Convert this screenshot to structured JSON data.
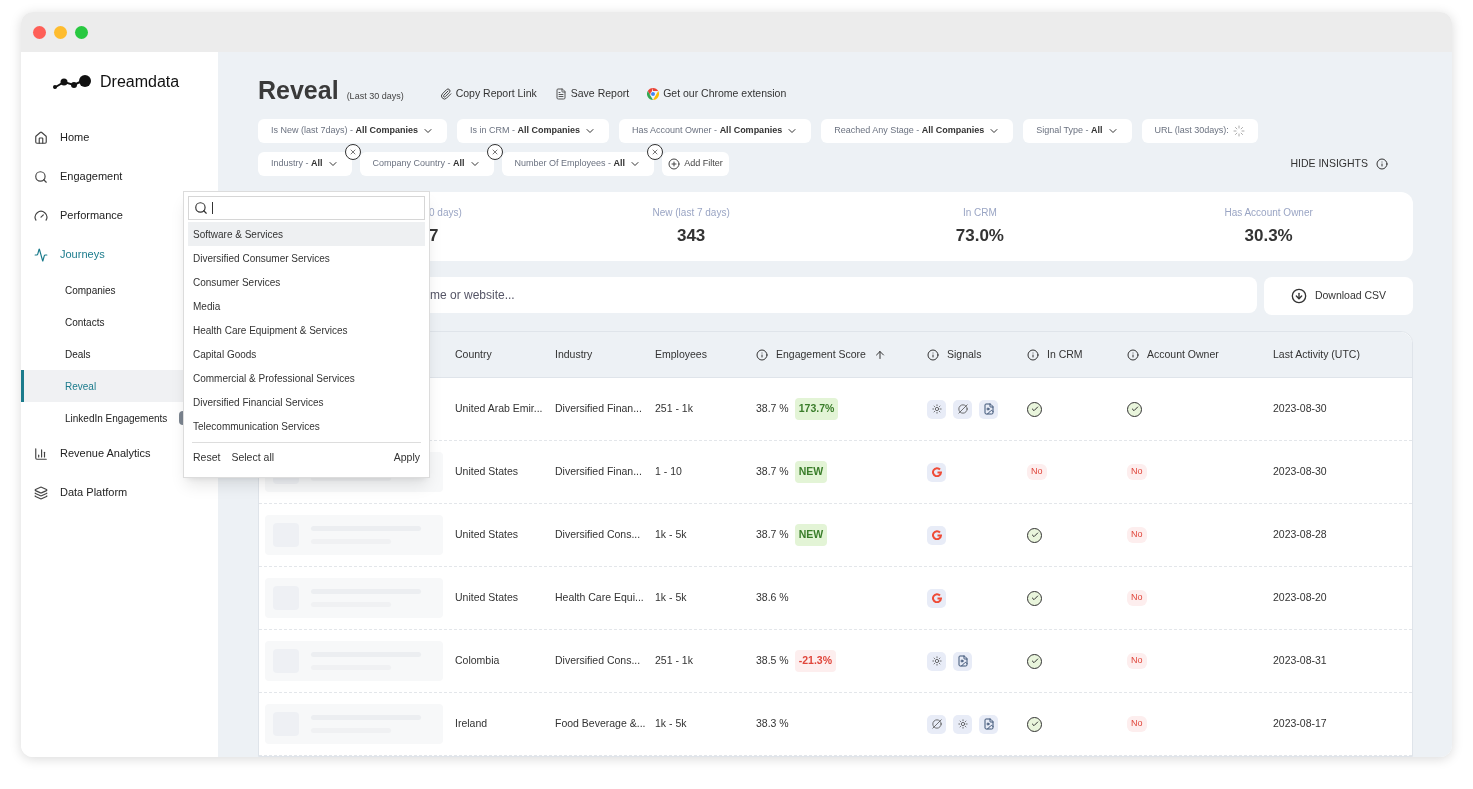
{
  "brand": "Dreamdata",
  "sidebar": {
    "items": [
      {
        "label": "Home",
        "kind": "home",
        "selected": false
      },
      {
        "label": "Engagement",
        "kind": "search",
        "selected": false
      },
      {
        "label": "Performance",
        "kind": "gauge",
        "selected": false
      },
      {
        "label": "Journeys",
        "kind": "journey",
        "selected": true,
        "children": [
          {
            "label": "Companies",
            "selected": false
          },
          {
            "label": "Contacts",
            "selected": false
          },
          {
            "label": "Deals",
            "selected": false
          },
          {
            "label": "Reveal",
            "selected": true
          },
          {
            "label": "LinkedIn Engagements",
            "selected": false,
            "badge": true
          }
        ]
      },
      {
        "label": "Revenue Analytics",
        "kind": "chart",
        "selected": false
      },
      {
        "label": "Data Platform",
        "kind": "layers",
        "selected": false
      }
    ]
  },
  "header": {
    "title": "Reveal",
    "subtitle": "(Last 30 days)",
    "actions": [
      {
        "label": "Copy Report Link",
        "kind": "clip"
      },
      {
        "label": "Save Report",
        "kind": "doc"
      },
      {
        "label": "Get our Chrome extension",
        "kind": "chrome"
      }
    ]
  },
  "filters": [
    [
      {
        "label": "Is New (last 7days) - ",
        "value": "All Companies",
        "kind": "select"
      },
      {
        "label": "Is in CRM - ",
        "value": "All Companies",
        "kind": "select"
      },
      {
        "label": "Has Account Owner - ",
        "value": "All Companies",
        "kind": "select"
      },
      {
        "label": "Reached Any Stage - ",
        "value": "All Companies",
        "kind": "select"
      },
      {
        "label": "Signal Type - ",
        "value": "All",
        "kind": "select"
      },
      {
        "label": "URL (last 30days):",
        "kind": "loading"
      }
    ],
    [
      {
        "label": "Industry - ",
        "value": "All",
        "kind": "removable"
      },
      {
        "label": "Company Country - ",
        "value": "All",
        "kind": "removable"
      },
      {
        "label": "Number Of Employees - ",
        "value": "All",
        "kind": "removable"
      },
      {
        "label": "Add Filter",
        "kind": "add"
      }
    ]
  ],
  "hide_insights": "HIDE INSIGHTS",
  "stats": [
    {
      "label": "0 days)",
      "value": "7",
      "kind": "partial"
    },
    {
      "label": "New (last 7 days)",
      "value": "343",
      "kind": "full"
    },
    {
      "label": "In CRM",
      "value": "73.0%",
      "kind": "full"
    },
    {
      "label": "Has Account Owner",
      "value": "30.3%",
      "kind": "full"
    }
  ],
  "search": {
    "placeholder": "me or website..."
  },
  "download_button": "Download CSV",
  "table": {
    "columns": [
      {
        "label": "Country",
        "kind": "plain"
      },
      {
        "label": "Industry",
        "kind": "plain"
      },
      {
        "label": "Employees",
        "kind": "plain"
      },
      {
        "label": "Engagement Score",
        "kind": "info_sorted"
      },
      {
        "label": "Signals",
        "kind": "info"
      },
      {
        "label": "In CRM",
        "kind": "info"
      },
      {
        "label": "Account Owner",
        "kind": "info"
      },
      {
        "label": "Last Activity (UTC)",
        "kind": "plain"
      }
    ],
    "rows": [
      {
        "country": "United Arab Emir...",
        "industry": "Diversified Finan...",
        "employees": "251 - 1k",
        "score": "38.7 %",
        "change": {
          "text": "173.7%",
          "kind": "up"
        },
        "signals": [
          {
            "kind": "sun"
          },
          {
            "kind": "half"
          },
          {
            "kind": "doc"
          }
        ],
        "in_crm": {
          "kind": "check"
        },
        "account_owner": {
          "kind": "check"
        },
        "last_activity": "2023-08-30"
      },
      {
        "company_visible": true,
        "country": "United States",
        "industry": "Diversified Finan...",
        "employees": "1 - 10",
        "score": "38.7 %",
        "change": {
          "text": "NEW",
          "kind": "up"
        },
        "signals": [
          {
            "kind": "g2"
          }
        ],
        "in_crm": {
          "kind": "no",
          "text": "No"
        },
        "account_owner": {
          "kind": "no",
          "text": "No"
        },
        "last_activity": "2023-08-30"
      },
      {
        "company_visible": true,
        "country": "United States",
        "industry": "Diversified Cons...",
        "employees": "1k - 5k",
        "score": "38.7 %",
        "change": {
          "text": "NEW",
          "kind": "up"
        },
        "signals": [
          {
            "kind": "g2"
          }
        ],
        "in_crm": {
          "kind": "check"
        },
        "account_owner": {
          "kind": "no",
          "text": "No"
        },
        "last_activity": "2023-08-28"
      },
      {
        "company_visible": true,
        "country": "United States",
        "industry": "Health Care Equi...",
        "employees": "1k - 5k",
        "score": "38.6 %",
        "signals": [
          {
            "kind": "g2"
          }
        ],
        "in_crm": {
          "kind": "check"
        },
        "account_owner": {
          "kind": "no",
          "text": "No"
        },
        "last_activity": "2023-08-20"
      },
      {
        "company_visible": true,
        "country": "Colombia",
        "industry": "Diversified Cons...",
        "employees": "251 - 1k",
        "score": "38.5 %",
        "change": {
          "text": "-21.3%",
          "kind": "down"
        },
        "signals": [
          {
            "kind": "sun"
          },
          {
            "kind": "doc"
          }
        ],
        "in_crm": {
          "kind": "check"
        },
        "account_owner": {
          "kind": "no",
          "text": "No"
        },
        "last_activity": "2023-08-31"
      },
      {
        "company_visible": true,
        "country": "Ireland",
        "industry": "Food Beverage &...",
        "employees": "1k - 5k",
        "score": "38.3 %",
        "signals": [
          {
            "kind": "half"
          },
          {
            "kind": "sun"
          },
          {
            "kind": "doc"
          }
        ],
        "in_crm": {
          "kind": "check"
        },
        "account_owner": {
          "kind": "no",
          "text": "No"
        },
        "last_activity": "2023-08-17"
      }
    ]
  },
  "dropdown": {
    "options": [
      {
        "label": "Software & Services",
        "selected": true
      },
      {
        "label": "Diversified Consumer Services",
        "selected": false
      },
      {
        "label": "Consumer Services",
        "selected": false
      },
      {
        "label": "Media",
        "selected": false
      },
      {
        "label": "Health Care Equipment & Services",
        "selected": false
      },
      {
        "label": "Capital Goods",
        "selected": false
      },
      {
        "label": "Commercial & Professional Services",
        "selected": false
      },
      {
        "label": "Diversified Financial Services",
        "selected": false
      },
      {
        "label": "Telecommunication Services",
        "selected": false
      }
    ],
    "reset": "Reset",
    "select_all": "Select all",
    "apply": "Apply"
  }
}
